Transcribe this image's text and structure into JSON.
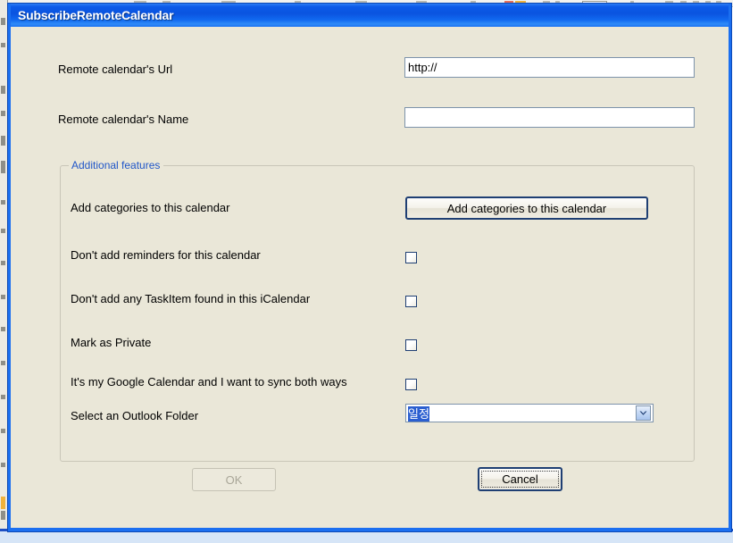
{
  "window": {
    "title": "SubscribeRemoteCalendar"
  },
  "form": {
    "url_label": "Remote calendar's Url",
    "url_value": "http://",
    "url_placeholder": "",
    "name_label": "Remote calendar's Name",
    "name_value": "",
    "name_placeholder": ""
  },
  "group": {
    "legend": "Additional features",
    "rows": [
      {
        "label": "Add categories to this calendar",
        "control": "button",
        "button_label": "Add categories to this calendar"
      },
      {
        "label": "Don't add reminders for this calendar",
        "control": "checkbox",
        "checked": false
      },
      {
        "label": "Don't add any TaskItem found in this iCalendar",
        "control": "checkbox",
        "checked": false
      },
      {
        "label": "Mark as Private",
        "control": "checkbox",
        "checked": false
      },
      {
        "label": "It's my Google Calendar and I want to sync both ways",
        "control": "checkbox",
        "checked": false
      },
      {
        "label": "Select an Outlook Folder",
        "control": "combobox",
        "selected": "일정"
      }
    ]
  },
  "footer": {
    "ok_label": "OK",
    "ok_enabled": false,
    "cancel_label": "Cancel",
    "cancel_focused": true
  },
  "colors": {
    "titlebar_blue": "#0c5ae8",
    "window_border": "#1b6ff0",
    "client_bg": "#EAE7D8",
    "legend_blue": "#2056c8",
    "control_border": "#7d93ab",
    "default_btn_border": "#1f3f73",
    "selection_blue": "#2b5fd0",
    "disabled_text": "#a9a698"
  }
}
